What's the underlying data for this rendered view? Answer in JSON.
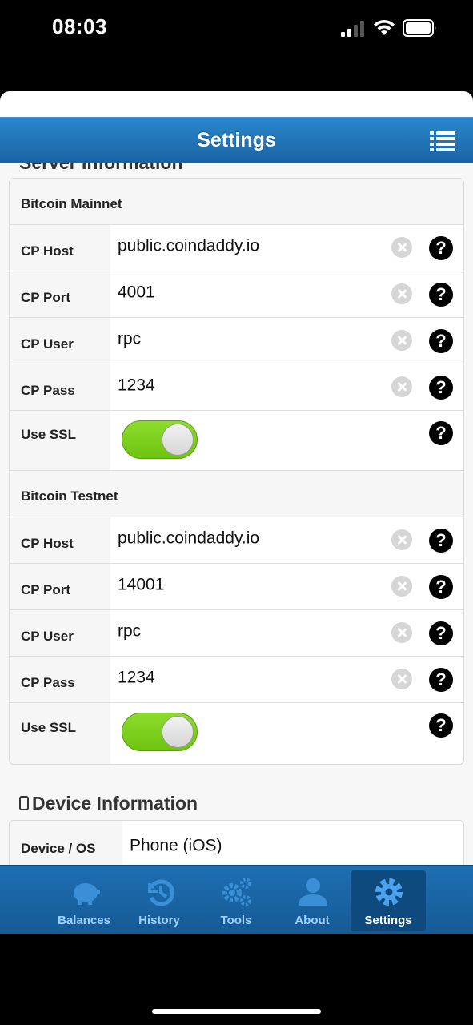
{
  "status_bar": {
    "time": "08:03"
  },
  "header": {
    "title": "Settings"
  },
  "content": {
    "section_server_partial": "Server Information",
    "mainnet": {
      "title": "Bitcoin Mainnet",
      "rows": [
        {
          "label": "CP Host",
          "value": "public.coindaddy.io"
        },
        {
          "label": "CP Port",
          "value": "4001"
        },
        {
          "label": "CP User",
          "value": "rpc"
        },
        {
          "label": "CP Pass",
          "value": "1234"
        }
      ],
      "ssl_label": "Use SSL",
      "ssl_on": true
    },
    "testnet": {
      "title": "Bitcoin Testnet",
      "rows": [
        {
          "label": "CP Host",
          "value": "public.coindaddy.io"
        },
        {
          "label": "CP Port",
          "value": "14001"
        },
        {
          "label": "CP User",
          "value": "rpc"
        },
        {
          "label": "CP Pass",
          "value": "1234"
        }
      ],
      "ssl_label": "Use SSL",
      "ssl_on": true
    },
    "device": {
      "title": "Device Information",
      "row": {
        "label": "Device / OS",
        "value": "Phone (iOS)"
      }
    }
  },
  "tabs": [
    {
      "label": "Balances",
      "icon": "piggy-bank-icon",
      "active": false
    },
    {
      "label": "History",
      "icon": "history-icon",
      "active": false
    },
    {
      "label": "Tools",
      "icon": "gears-icon",
      "active": false
    },
    {
      "label": "About",
      "icon": "user-icon",
      "active": false
    },
    {
      "label": "Settings",
      "icon": "gear-icon",
      "active": true
    }
  ],
  "colors": {
    "header_blue": "#1f74b8",
    "toggle_green": "#7dd01e",
    "tab_label": "#9fd1ff"
  }
}
